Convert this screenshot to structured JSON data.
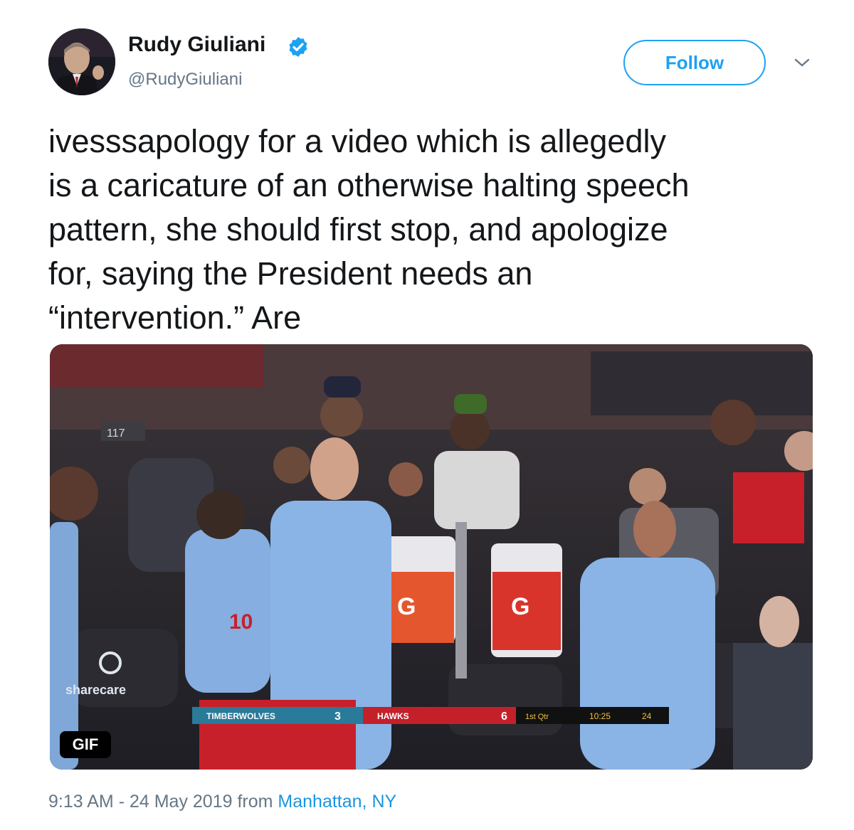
{
  "author": {
    "name": "Rudy Giuliani",
    "handle": "@RudyGiuliani",
    "verified": true
  },
  "follow_button": {
    "label": "Follow"
  },
  "tweet": {
    "text": "ivesssapology for a video which is allegedly\nis a caricature of an otherwise halting speech\npattern, she should first stop, and apologize\nfor, saying the President needs an\n“intervention.” Are"
  },
  "media": {
    "badge": "GIF",
    "seat_number": "117",
    "jersey_number": "10",
    "scorebug": {
      "team_left": "TIMBERWOLVES",
      "score_left": "3",
      "team_right": "HAWKS",
      "score_right": "6",
      "quarter": "1st Qtr",
      "clock": "10:25",
      "shot_clock": "24"
    },
    "watermark": "sharecare"
  },
  "meta": {
    "time": "9:13 AM",
    "separator": "-",
    "date": "24 May 2019",
    "from_label": "from",
    "location": "Manhattan, NY"
  },
  "colors": {
    "twitter_blue": "#1da1f2",
    "link_blue": "#1b95e0",
    "text_primary": "#14171a",
    "text_secondary": "#657786"
  }
}
